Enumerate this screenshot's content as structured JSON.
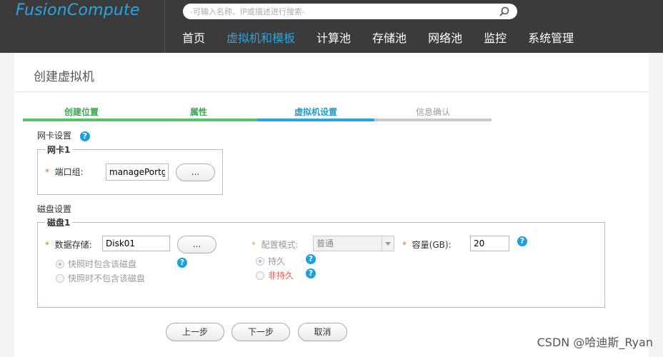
{
  "app": {
    "logo": "FusionCompute"
  },
  "search": {
    "placeholder": "-可输入名称、IP或描述进行搜索-"
  },
  "nav": {
    "items": [
      {
        "label": "首页"
      },
      {
        "label": "虚拟机和模板"
      },
      {
        "label": "计算池"
      },
      {
        "label": "存储池"
      },
      {
        "label": "网络池"
      },
      {
        "label": "监控"
      },
      {
        "label": "系统管理"
      }
    ],
    "active_index": 1
  },
  "page": {
    "title": "创建虚拟机"
  },
  "steps": [
    {
      "label": "创建位置",
      "state": "done"
    },
    {
      "label": "属性",
      "state": "done"
    },
    {
      "label": "虚拟机设置",
      "state": "current"
    },
    {
      "label": "信息确认",
      "state": "pending"
    }
  ],
  "nic": {
    "section_title": "网卡设置",
    "help_icon": "?",
    "group_legend": "网卡1",
    "port_group_label": "端口组:",
    "port_group_value": "managePortg",
    "browse_label": "..."
  },
  "disk": {
    "section_title": "磁盘设置",
    "group_legend": "磁盘1",
    "datastore_label": "数据存储:",
    "datastore_value": "Disk01",
    "browse_label": "...",
    "config_mode_label": "配置模式:",
    "config_mode_value": "普通",
    "capacity_label": "容量(GB):",
    "capacity_value": "20",
    "help_icon": "?",
    "snapshot_options": [
      {
        "label": "快照时包含该磁盘",
        "checked": true
      },
      {
        "label": "快照时不包含该磁盘",
        "checked": false
      }
    ],
    "persistence_options": [
      {
        "label": "持久",
        "checked": true
      },
      {
        "label": "非持久",
        "checked": false
      }
    ]
  },
  "buttons": {
    "prev": "上一步",
    "next": "下一步",
    "cancel": "取消"
  },
  "watermark": "CSDN @哈迪斯_Ryan",
  "colors": {
    "topbar": "#3b3b3b",
    "accent_blue": "#2aa6de",
    "step_done": "#55c26b",
    "step_current": "#27a9df",
    "step_pending": "#c8c8c8",
    "required": "#e86a10",
    "non_persistent": "#e55a5a"
  }
}
